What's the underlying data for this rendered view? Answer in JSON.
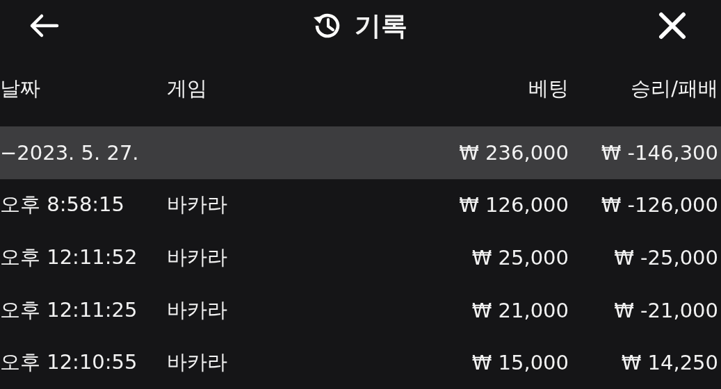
{
  "header": {
    "title": "기록"
  },
  "columns": [
    "날짜",
    "게임",
    "베팅",
    "승리/패배"
  ],
  "groups": [
    {
      "date": "−2023. 5. 27.",
      "expanded": true,
      "bet": "₩ 236,000",
      "result": "₩ -146,300",
      "rows": [
        {
          "time": "오후 8:58:15",
          "game": "바카라",
          "bet": "₩ 126,000",
          "result": "₩ -126,000"
        },
        {
          "time": "오후 12:11:52",
          "game": "바카라",
          "bet": "₩ 25,000",
          "result": "₩ -25,000"
        },
        {
          "time": "오후 12:11:25",
          "game": "바카라",
          "bet": "₩ 21,000",
          "result": "₩ -21,000"
        },
        {
          "time": "오후 12:10:55",
          "game": "바카라",
          "bet": "₩ 15,000",
          "result": "₩ 14,250"
        }
      ]
    }
  ]
}
